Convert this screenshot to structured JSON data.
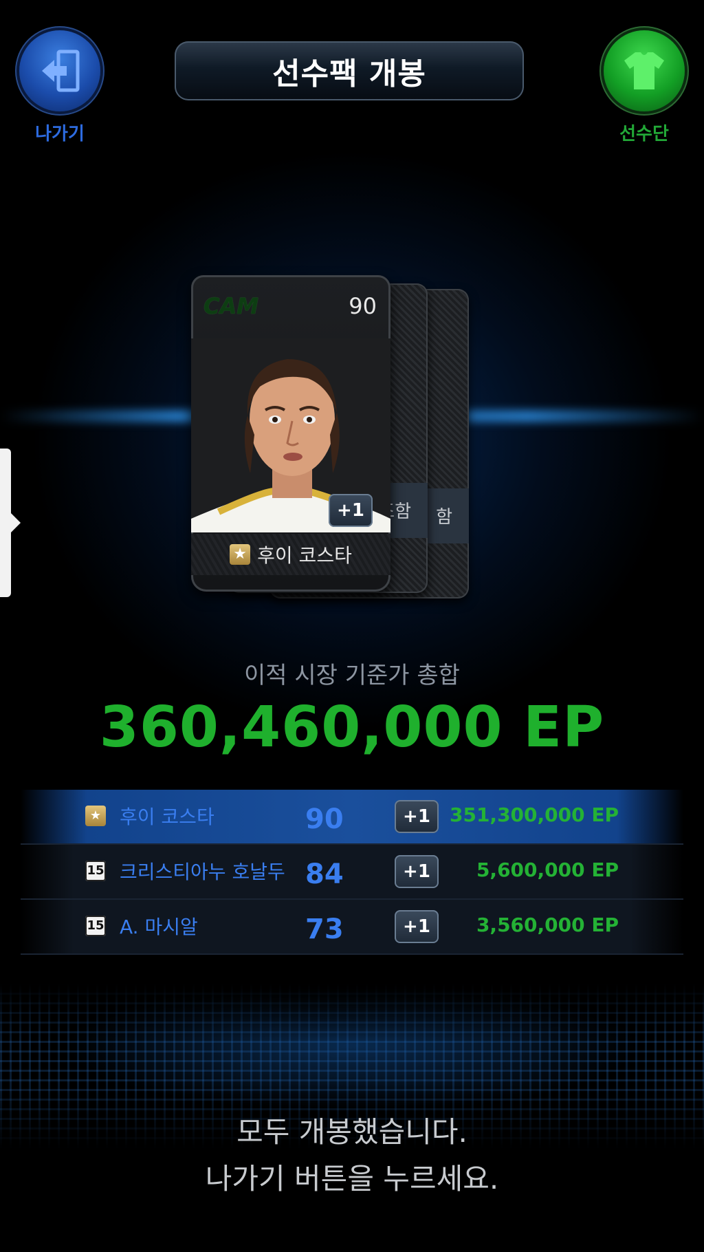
{
  "header": {
    "title": "선수팩 개봉",
    "exit_label": "나가기",
    "squad_label": "선수단"
  },
  "card": {
    "position": "CAM",
    "overall": "90",
    "badge": "+1",
    "name": "후이 코스타",
    "back_card_text": "함",
    "back_card_text_partial": "조함"
  },
  "summary": {
    "label": "이적 시장 기준가 총합",
    "total": "360,460,000 EP"
  },
  "players": [
    {
      "grade": "★",
      "name": "후이 코스타",
      "overall": "90",
      "badge": "+1",
      "value": "351,300,000 EP"
    },
    {
      "grade": "15",
      "name": "크리스티아누 호날두",
      "overall": "84",
      "badge": "+1",
      "value": "5,600,000 EP"
    },
    {
      "grade": "15",
      "name": "A. 마시알",
      "overall": "73",
      "badge": "+1",
      "value": "3,560,000 EP"
    }
  ],
  "footer": {
    "line1": "모두 개봉했습니다.",
    "line2": "나가기 버튼을 누르세요."
  },
  "colors": {
    "accent_blue": "#3a7ef0",
    "accent_green": "#1fb02d",
    "exit_button": "#1b4cab",
    "squad_button": "#139f25"
  },
  "icons": {
    "exit": "exit-door-icon",
    "squad": "jersey-icon",
    "grade_star": "star-grade-icon",
    "handle": "chevron-right-icon"
  }
}
